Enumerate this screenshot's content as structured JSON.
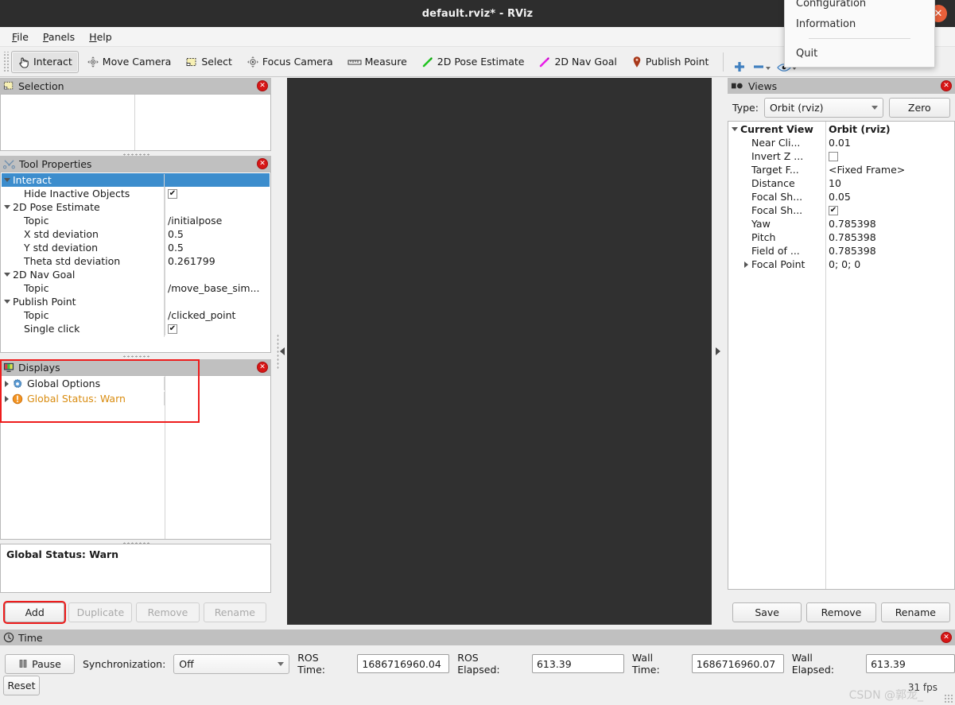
{
  "window": {
    "title": "default.rviz* - RViz",
    "controls": {
      "minimize": "minimize-icon",
      "maximize": "maximize-icon",
      "close": "✕"
    }
  },
  "menubar": {
    "items": [
      {
        "label": "File",
        "accel": "F"
      },
      {
        "label": "Panels",
        "accel": "P"
      },
      {
        "label": "Help",
        "accel": "H"
      }
    ]
  },
  "toolbar": {
    "tools": [
      {
        "label": "Interact",
        "icon": "hand-cursor-icon",
        "active": true
      },
      {
        "label": "Move Camera",
        "icon": "move-camera-icon",
        "active": false
      },
      {
        "label": "Select",
        "icon": "select-rect-icon",
        "active": false
      },
      {
        "label": "Focus Camera",
        "icon": "focus-camera-icon",
        "active": false
      },
      {
        "label": "Measure",
        "icon": "ruler-icon",
        "active": false
      },
      {
        "label": "2D Pose Estimate",
        "icon": "green-arrow-icon",
        "active": false
      },
      {
        "label": "2D Nav Goal",
        "icon": "magenta-arrow-icon",
        "active": false
      },
      {
        "label": "Publish Point",
        "icon": "map-pin-icon",
        "active": false
      }
    ],
    "extra_icons": [
      {
        "name": "add-tool-icon",
        "glyph": "plus"
      },
      {
        "name": "remove-tool-icon",
        "glyph": "minus"
      },
      {
        "name": "visibility-eye-icon",
        "glyph": "eye"
      }
    ]
  },
  "popup_menu": {
    "items": [
      "Configuration",
      "Information",
      "Quit"
    ],
    "separator_after": "Information"
  },
  "selection_panel": {
    "title": "Selection",
    "icon": "selection-icon"
  },
  "tool_properties_panel": {
    "title": "Tool Properties",
    "icon": "tool-properties-icon",
    "rows": [
      {
        "indent": 0,
        "twist": "open",
        "label": "Interact",
        "value": "",
        "type": "group",
        "selected": true
      },
      {
        "indent": 2,
        "twist": "none",
        "label": "Hide Inactive Objects",
        "value": "",
        "type": "checkbox",
        "checked": true
      },
      {
        "indent": 0,
        "twist": "open",
        "label": "2D Pose Estimate",
        "value": "",
        "type": "group"
      },
      {
        "indent": 2,
        "twist": "none",
        "label": "Topic",
        "value": "/initialpose",
        "type": "text"
      },
      {
        "indent": 2,
        "twist": "none",
        "label": "X std deviation",
        "value": "0.5",
        "type": "text"
      },
      {
        "indent": 2,
        "twist": "none",
        "label": "Y std deviation",
        "value": "0.5",
        "type": "text"
      },
      {
        "indent": 2,
        "twist": "none",
        "label": "Theta std deviation",
        "value": "0.261799",
        "type": "text"
      },
      {
        "indent": 0,
        "twist": "open",
        "label": "2D Nav Goal",
        "value": "",
        "type": "group"
      },
      {
        "indent": 2,
        "twist": "none",
        "label": "Topic",
        "value": "/move_base_sim...",
        "type": "text"
      },
      {
        "indent": 0,
        "twist": "open",
        "label": "Publish Point",
        "value": "",
        "type": "group"
      },
      {
        "indent": 2,
        "twist": "none",
        "label": "Topic",
        "value": "/clicked_point",
        "type": "text"
      },
      {
        "indent": 2,
        "twist": "none",
        "label": "Single click",
        "value": "",
        "type": "checkbox",
        "checked": true
      }
    ]
  },
  "displays_panel": {
    "title": "Displays",
    "icon": "displays-icon",
    "highlighted": true,
    "rows": [
      {
        "twist": "closed",
        "icon": "gear-icon",
        "label": "Global Options",
        "color": "#1c1c1c"
      },
      {
        "twist": "closed",
        "icon": "warning-icon",
        "label": "Global Status: Warn",
        "color": "#d98c10"
      }
    ],
    "detail_text": "Global Status: Warn",
    "buttons": [
      {
        "label": "Add",
        "enabled": true,
        "highlighted": true
      },
      {
        "label": "Duplicate",
        "enabled": false,
        "highlighted": false
      },
      {
        "label": "Remove",
        "enabled": false,
        "highlighted": false
      },
      {
        "label": "Rename",
        "enabled": false,
        "highlighted": false
      }
    ]
  },
  "views_panel": {
    "title": "Views",
    "icon": "views-icon",
    "type_label": "Type:",
    "type_value": "Orbit (rviz)",
    "zero_button": "Zero",
    "rows": [
      {
        "indent": 0,
        "twist": "open",
        "label": "Current View",
        "value": "Orbit (rviz)",
        "bold": true
      },
      {
        "indent": 2,
        "twist": "none",
        "label": "Near Cli...",
        "value": "0.01"
      },
      {
        "indent": 2,
        "twist": "none",
        "label": "Invert Z ...",
        "value": "",
        "type": "checkbox",
        "checked": false
      },
      {
        "indent": 2,
        "twist": "none",
        "label": "Target F...",
        "value": "<Fixed Frame>"
      },
      {
        "indent": 2,
        "twist": "none",
        "label": "Distance",
        "value": "10"
      },
      {
        "indent": 2,
        "twist": "none",
        "label": "Focal Sh...",
        "value": "0.05"
      },
      {
        "indent": 2,
        "twist": "none",
        "label": "Focal Sh...",
        "value": "",
        "type": "checkbox",
        "checked": true
      },
      {
        "indent": 2,
        "twist": "none",
        "label": "Yaw",
        "value": "0.785398"
      },
      {
        "indent": 2,
        "twist": "none",
        "label": "Pitch",
        "value": "0.785398"
      },
      {
        "indent": 2,
        "twist": "none",
        "label": "Field of ...",
        "value": "0.785398"
      },
      {
        "indent": 1,
        "twist": "closed",
        "label": "Focal Point",
        "value": "0; 0; 0"
      }
    ],
    "buttons": [
      "Save",
      "Remove",
      "Rename"
    ]
  },
  "time_panel": {
    "title": "Time",
    "icon": "clock-icon",
    "pause_button": "Pause",
    "reset_button": "Reset",
    "sync_label": "Synchronization:",
    "sync_value": "Off",
    "fields": [
      {
        "label": "ROS Time:",
        "value": "1686716960.04"
      },
      {
        "label": "ROS Elapsed:",
        "value": "613.39"
      },
      {
        "label": "Wall Time:",
        "value": "1686716960.07"
      },
      {
        "label": "Wall Elapsed:",
        "value": "613.39"
      }
    ]
  },
  "status": {
    "fps": "31 fps",
    "watermark": "CSDN @郭龙_"
  },
  "colors": {
    "accent_selection": "#3c8dcd",
    "warn": "#d98c10",
    "highlight_box": "#ee1c1c",
    "viewport": "#303030",
    "panel_header": "#c0c0c0"
  }
}
